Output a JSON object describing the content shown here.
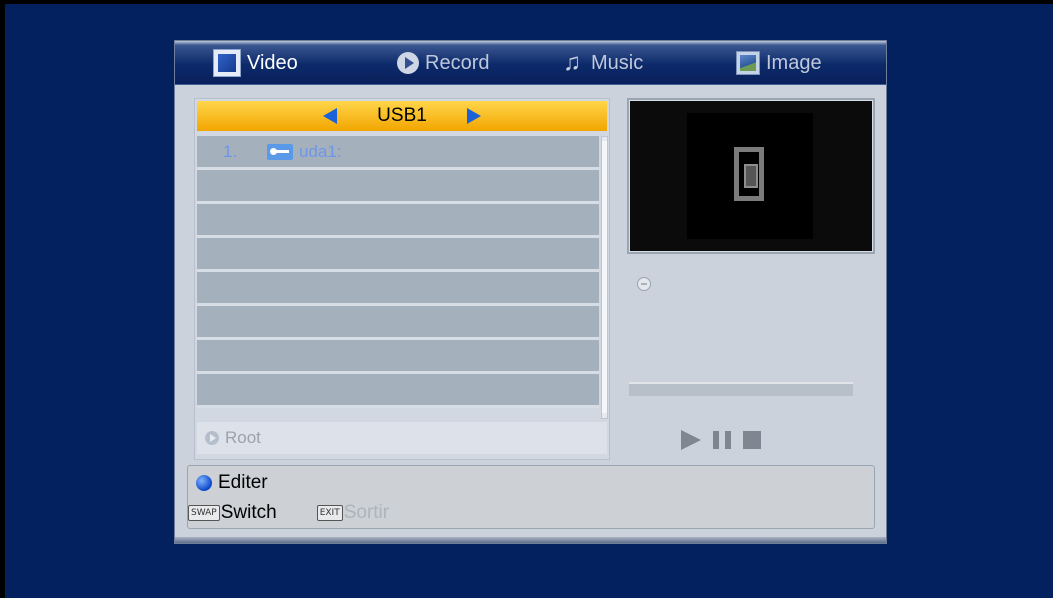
{
  "tabs": [
    {
      "label": "Video",
      "icon": "video-icon",
      "active": true
    },
    {
      "label": "Record",
      "icon": "record-icon",
      "active": false
    },
    {
      "label": "Music",
      "icon": "music-note-icon",
      "active": false
    },
    {
      "label": "Image",
      "icon": "image-icon",
      "active": false
    }
  ],
  "device": {
    "name": "USB1"
  },
  "files": [
    {
      "index": "1.",
      "icon": "usb-icon",
      "name": "uda1:"
    }
  ],
  "path": {
    "label": "Root"
  },
  "player": {
    "progress": 0
  },
  "help": {
    "edit_label": "Editer",
    "swap_key": "SWAP",
    "switch_label": "Switch",
    "exit_key": "EXIT",
    "exit_label": "Sortir"
  },
  "colors": {
    "background": "#02215e",
    "device_bar": "#f2a500",
    "file_text": "#6f96e6",
    "edit_dot": "#0b47c8"
  }
}
